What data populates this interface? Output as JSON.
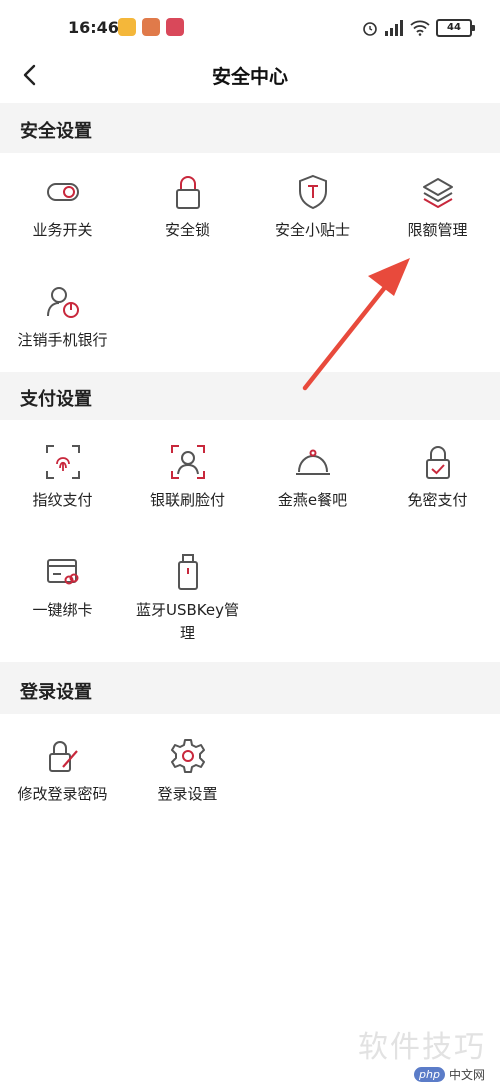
{
  "status_bar": {
    "time": "16:46",
    "battery": "44"
  },
  "header": {
    "title": "安全中心"
  },
  "sections": [
    {
      "title": "安全设置",
      "items": [
        {
          "label": "业务开关",
          "icon": "toggle-icon"
        },
        {
          "label": "安全锁",
          "icon": "lock-icon"
        },
        {
          "label": "安全小贴士",
          "icon": "shield-t-icon"
        },
        {
          "label": "限额管理",
          "icon": "layers-icon"
        },
        {
          "label": "注销手机银行",
          "icon": "user-power-icon"
        }
      ]
    },
    {
      "title": "支付设置",
      "items": [
        {
          "label": "指纹支付",
          "icon": "fingerprint-icon"
        },
        {
          "label": "银联刷脸付",
          "icon": "face-scan-icon"
        },
        {
          "label": "金燕e餐吧",
          "icon": "dish-cover-icon"
        },
        {
          "label": "免密支付",
          "icon": "lock-check-icon"
        },
        {
          "label": "一键绑卡",
          "icon": "card-link-icon"
        },
        {
          "label": "蓝牙USBKey管理",
          "icon": "usb-key-icon"
        }
      ]
    },
    {
      "title": "登录设置",
      "items": [
        {
          "label": "修改登录密码",
          "icon": "edit-password-icon"
        },
        {
          "label": "登录设置",
          "icon": "gear-icon"
        }
      ]
    }
  ],
  "colors": {
    "accent": "#c8283c",
    "icon_gray": "#555555",
    "section_bg": "#f4f4f4",
    "arrow": "#e84a3c"
  },
  "watermark": {
    "text": "软件技巧",
    "logo_php": "php",
    "logo_cn": "中文网"
  }
}
